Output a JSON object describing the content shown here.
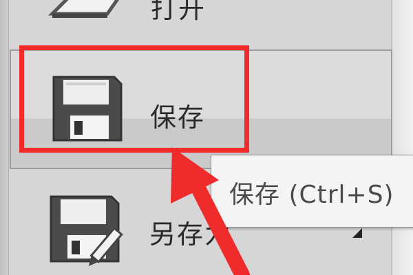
{
  "menu": {
    "items": [
      {
        "label": "打开",
        "icon": "folder-open-icon"
      },
      {
        "label": "保存",
        "icon": "floppy-disk-icon",
        "highlighted": true
      },
      {
        "label": "另存为",
        "icon": "floppy-disk-pencil-icon",
        "has_submenu": true
      }
    ]
  },
  "tooltip": {
    "text": "保存 (Ctrl+S)"
  },
  "annotation": {
    "color": "#ef2b2b"
  }
}
